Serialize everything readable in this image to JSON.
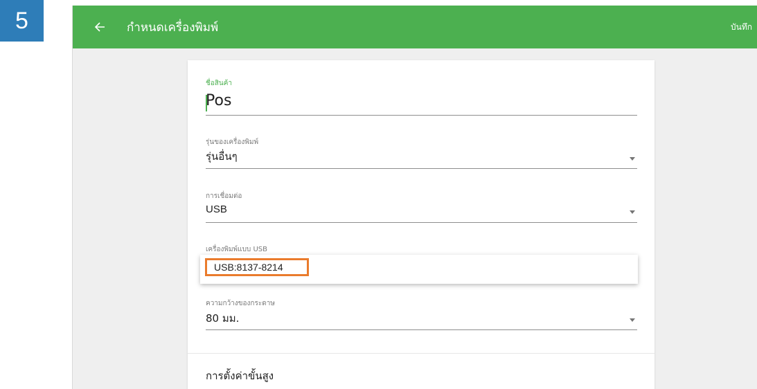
{
  "step_badge": "5",
  "appbar": {
    "title": "กำหนดเครื่องพิมพ์",
    "save_label": "บันทึก",
    "back_icon": "arrow-left-icon",
    "color": "#4cb050"
  },
  "form": {
    "product_name": {
      "label": "ชื่อสินค้า",
      "value": "Pos"
    },
    "printer_model": {
      "label": "รุ่นของเครื่องพิมพ์",
      "value": "รุ่นอื่นๆ"
    },
    "connection": {
      "label": "การเชื่อมต่อ",
      "value": "USB"
    },
    "usb_printer": {
      "label": "เครื่องพิมพ์แบบ USB",
      "options": [
        "USB:8137-8214"
      ]
    },
    "paper_width": {
      "label": "ความกว้างของกระดาษ",
      "value": "80 มม."
    },
    "advanced_settings": "การตั้งค่าขั้นสูง"
  },
  "colors": {
    "highlight": "#ea7b2c",
    "badge": "#2e7db8"
  }
}
